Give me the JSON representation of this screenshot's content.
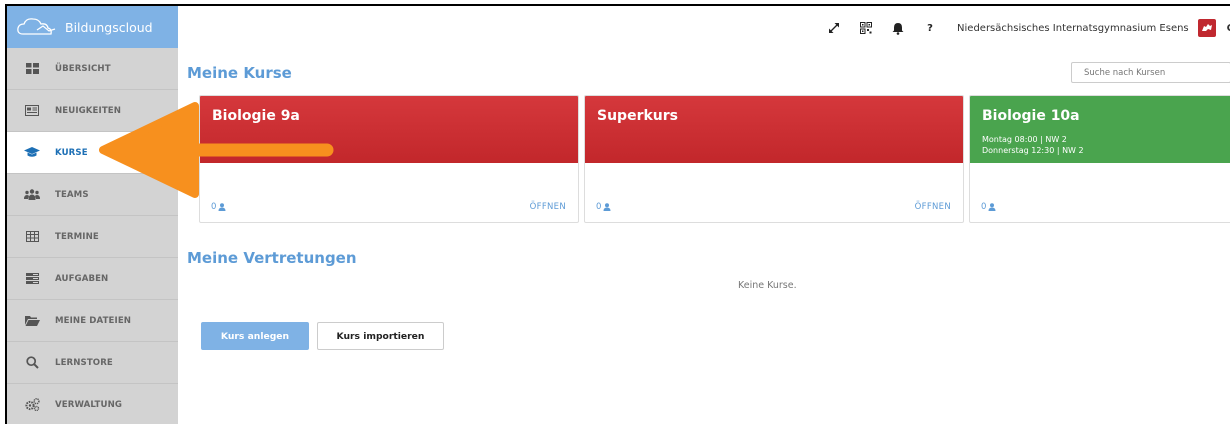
{
  "brand": {
    "name": "Bildungscloud",
    "icon": "cloud-logo-icon"
  },
  "sidebar": {
    "items": [
      {
        "label": "ÜBERSICHT",
        "icon": "dashboard-icon"
      },
      {
        "label": "NEUIGKEITEN",
        "icon": "news-icon"
      },
      {
        "label": "KURSE",
        "icon": "graduation-cap-icon",
        "active": true
      },
      {
        "label": "TEAMS",
        "icon": "team-icon"
      },
      {
        "label": "TERMINE",
        "icon": "calendar-icon"
      },
      {
        "label": "AUFGABEN",
        "icon": "tasks-icon"
      },
      {
        "label": "MEINE DATEIEN",
        "icon": "folder-icon"
      },
      {
        "label": "LERNSTORE",
        "icon": "search-icon"
      },
      {
        "label": "VERWALTUNG",
        "icon": "cogs-icon"
      }
    ]
  },
  "topbar": {
    "help": "?",
    "school": "Niedersächsisches Internatsgymnasium Esens",
    "user_initial": "C"
  },
  "main": {
    "courses_heading": "Meine Kurse",
    "search_placeholder": "Suche nach Kursen",
    "courses": [
      {
        "title": "Biologie 9a",
        "color": "#c82b2f",
        "times": [],
        "members": "0",
        "open": "ÖFFNEN"
      },
      {
        "title": "Superkurs",
        "color": "#c82b2f",
        "times": [],
        "members": "0",
        "open": "ÖFFNEN"
      },
      {
        "title": "Biologie 10a",
        "color": "#4aa44e",
        "times": [
          "Montag 08:00 | NW 2",
          "Donnerstag 12:30 | NW 2"
        ],
        "members": "0"
      }
    ],
    "substitutions_heading": "Meine Vertretungen",
    "no_courses": "Keine Kurse.",
    "create_button": "Kurs anlegen",
    "import_button": "Kurs importieren"
  },
  "annotation": {
    "color": "#f7901e"
  }
}
